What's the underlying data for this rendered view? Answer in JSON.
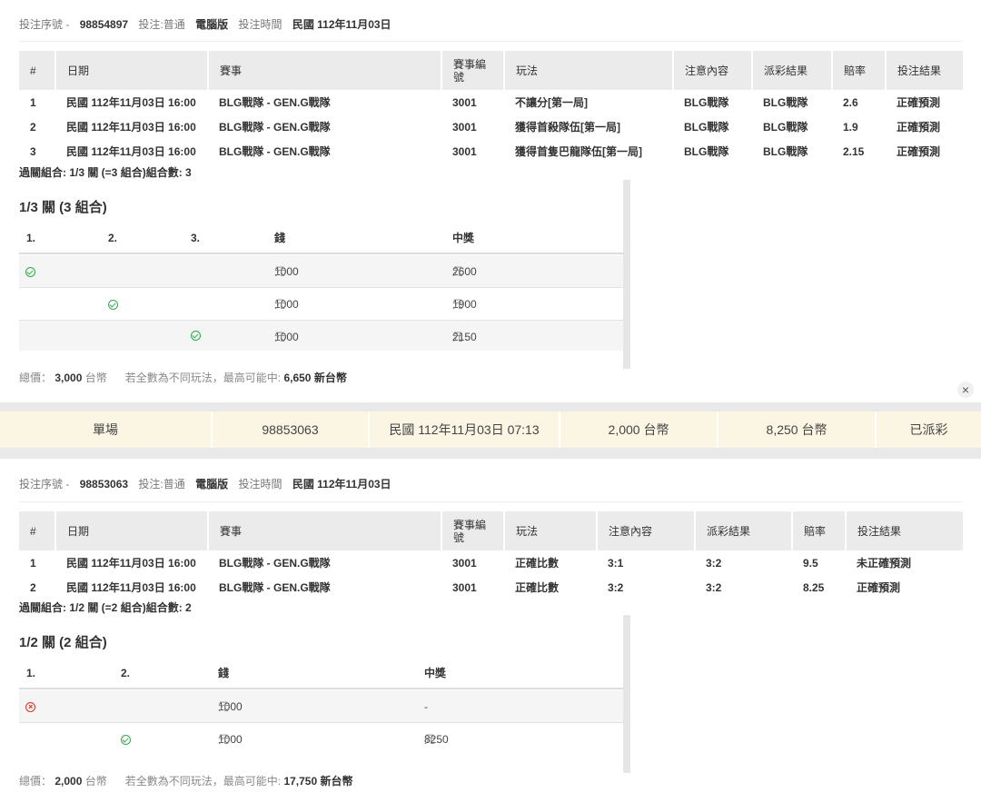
{
  "bet1": {
    "header": {
      "serial_label": "投注序號 -",
      "serial": "98854897",
      "type_label": "投注:普通",
      "platform": "電腦版",
      "time_label": "投注時間",
      "date": "民國 112年11月03日"
    },
    "columns": [
      "#",
      "日期",
      "賽事",
      "賽事編號",
      "玩法",
      "注意內容",
      "派彩結果",
      "賠率",
      "投注結果"
    ],
    "rows": [
      [
        "1",
        "民國 112年11月03日 16:00",
        "BLG戰隊 - GEN.G戰隊",
        "3001",
        "不讓分[第一局]",
        "BLG戰隊",
        "BLG戰隊",
        "2.6",
        "正確預測"
      ],
      [
        "2",
        "民國 112年11月03日 16:00",
        "BLG戰隊 - GEN.G戰隊",
        "3001",
        "獲得首殺隊伍[第一局]",
        "BLG戰隊",
        "BLG戰隊",
        "1.9",
        "正確預測"
      ],
      [
        "3",
        "民國 112年11月03日 16:00",
        "BLG戰隊 - GEN.G戰隊",
        "3001",
        "獲得首隻巴龍隊伍[第一局]",
        "BLG戰隊",
        "BLG戰隊",
        "2.15",
        "正確預測"
      ]
    ],
    "combo_line": "過關組合: 1/3 關 (=3 組合)組合數: 3",
    "combo_title": "1/3 關 (3 組合)",
    "combo_headers": [
      "1.",
      "2.",
      "3.",
      "錢",
      "中獎"
    ],
    "combos": [
      {
        "stake": "1000",
        "win": "2600",
        "mark": "check"
      },
      {
        "stake": "1000",
        "win": "1900",
        "mark": "check"
      },
      {
        "stake": "1000",
        "win": "2150",
        "mark": "check"
      }
    ],
    "unit": "元",
    "total_label": "總價：",
    "total_value": "3,000",
    "total_unit": "台幣",
    "note": "若全數為不同玩法，最高可能中:",
    "max_win": "6,650 新台幣"
  },
  "close_icon_text": "×",
  "summary": [
    "單場",
    "98853063",
    "民國 112年11月03日 07:13",
    "2,000 台幣",
    "8,250 台幣",
    "已派彩"
  ],
  "bet2": {
    "header": {
      "serial_label": "投注序號 -",
      "serial": "98853063",
      "type_label": "投注:普通",
      "platform": "電腦版",
      "time_label": "投注時間",
      "date": "民國 112年11月03日"
    },
    "columns": [
      "#",
      "日期",
      "賽事",
      "賽事編號",
      "玩法",
      "注意內容",
      "派彩結果",
      "賠率",
      "投注結果"
    ],
    "rows": [
      [
        "1",
        "民國 112年11月03日 16:00",
        "BLG戰隊 - GEN.G戰隊",
        "3001",
        "正確比數",
        "3:1",
        "3:2",
        "9.5",
        "未正確預測"
      ],
      [
        "2",
        "民國 112年11月03日 16:00",
        "BLG戰隊 - GEN.G戰隊",
        "3001",
        "正確比數",
        "3:2",
        "3:2",
        "8.25",
        "正確預測"
      ]
    ],
    "combo_line": "過關組合: 1/2 關 (=2 組合)組合數: 2",
    "combo_title": "1/2 關 (2 組合)",
    "combo_headers": [
      "1.",
      "2.",
      "錢",
      "中獎"
    ],
    "combos": [
      {
        "stake": "1000",
        "win": "-",
        "mark": "cross"
      },
      {
        "stake": "1000",
        "win": "8250",
        "mark": "check"
      }
    ],
    "unit": "元",
    "total_label": "總價：",
    "total_value": "2,000",
    "total_unit": "台幣",
    "note": "若全數為不同玩法，最高可能中:",
    "max_win": "17,750 新台幣"
  }
}
